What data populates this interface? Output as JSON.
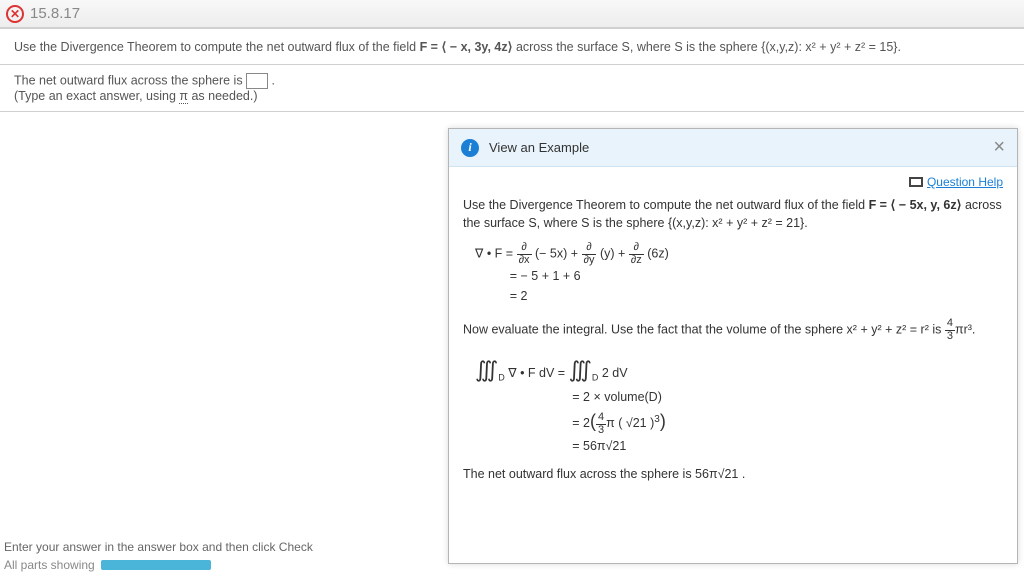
{
  "header": {
    "section_number": "15.8.17"
  },
  "question": {
    "prefix": "Use the Divergence Theorem to compute the net outward flux of the field ",
    "field_expr": "F = ⟨ − x, 3y, 4z⟩",
    "middle": " across the surface S, where S is the sphere ",
    "sphere_expr": "{(x,y,z): x² + y² + z² = 15}",
    "suffix": "."
  },
  "response": {
    "sentence_before_box": "The net outward flux across the sphere is ",
    "sentence_after_box": " .",
    "format_hint_before": "(Type an exact answer, using ",
    "format_hint_pi": "π",
    "format_hint_after": " as needed.)"
  },
  "popup": {
    "title": "View an Example",
    "question_help": "Question Help",
    "ex_q_prefix": "Use the Divergence Theorem to compute the net outward flux of the field ",
    "ex_field": "F = ⟨ − 5x, y, 6z⟩",
    "ex_q_mid": " across the surface S, where S is the sphere ",
    "ex_sphere": "{(x,y,z): x² + y² + z² = 21}",
    "ex_q_suf": ".",
    "div_lhs": "∇ • F  =  ",
    "div_rhs": "(− 5x) + ",
    "div_rhs2": "(y) + ",
    "div_rhs3": "(6z)",
    "div_simp1": "=  − 5 + 1 + 6",
    "div_simp2": "=  2",
    "vol_sentence_a": "Now evaluate the integral. Use the fact that the volume of the sphere x² + y² + z² = r² is ",
    "vol_sentence_b": "πr³.",
    "integral_lhs": "∇ • F dV  =  ",
    "integral_rhs": "2 dV",
    "int_step1": "=  2 × volume(D)",
    "int_step2_a": "=  2",
    "int_step2_b": "π ( √21 )",
    "int_result": "=  56π√21",
    "conclusion": "The net outward flux across the sphere is 56π√21 ."
  },
  "footer": {
    "enter_hint": "Enter your answer in the answer box and then click Check",
    "all_parts": "All parts showing"
  }
}
